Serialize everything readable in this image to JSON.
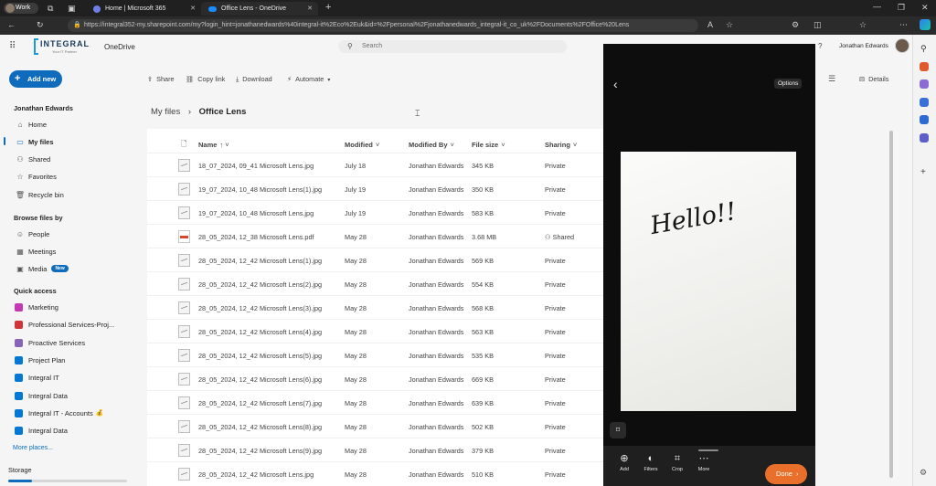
{
  "browser": {
    "profile": "Work",
    "tabs": [
      {
        "label": "Home | Microsoft 365",
        "active": false
      },
      {
        "label": "Office Lens - OneDrive",
        "active": true
      }
    ],
    "url": "https://integral352-my.sharepoint.com/my?login_hint=jonathanedwards%40integral-it%2Eco%2Euk&id=%2Fpersonal%2Fjonathanedwards_integral-it_co_uk%2FDocuments%2FOffice%20Lens"
  },
  "suite": {
    "logo_text": "INTEGRAL",
    "logo_tagline": "Your IT Partner",
    "app_name": "OneDrive",
    "search_placeholder": "Search",
    "user_name": "Jonathan Edwards"
  },
  "sidebar": {
    "add_new": "Add new",
    "user": "Jonathan Edwards",
    "items": [
      {
        "label": "Home",
        "icon": "home-icon"
      },
      {
        "label": "My files",
        "icon": "folder-icon",
        "selected": true
      },
      {
        "label": "Shared",
        "icon": "people-icon"
      },
      {
        "label": "Favorites",
        "icon": "star-icon"
      },
      {
        "label": "Recycle bin",
        "icon": "trash-icon"
      }
    ],
    "browse_heading": "Browse files by",
    "browse": [
      {
        "label": "People",
        "icon": "person-icon"
      },
      {
        "label": "Meetings",
        "icon": "calendar-icon"
      },
      {
        "label": "Media",
        "icon": "image-icon",
        "badge": "New"
      }
    ],
    "quick_access_heading": "Quick access",
    "quick_access": [
      {
        "label": "Marketing",
        "color": "#c239b3"
      },
      {
        "label": "Professional Services-Proj...",
        "color": "#d13438"
      },
      {
        "label": "Proactive Services",
        "color": "#8764b8"
      },
      {
        "label": "Project Plan",
        "color": "#0078d4"
      },
      {
        "label": "Integral IT",
        "color": "#0078d4"
      },
      {
        "label": "Integral Data",
        "color": "#0078d4"
      },
      {
        "label": "Integral IT - Accounts",
        "color": "#0078d4",
        "emoji": "💰"
      },
      {
        "label": "Integral Data",
        "color": "#0078d4"
      }
    ],
    "more_places": "More places...",
    "storage": "Storage"
  },
  "toolbar": {
    "share": "Share",
    "copy_link": "Copy link",
    "download": "Download",
    "automate": "Automate",
    "details": "Details"
  },
  "breadcrumb": {
    "parent": "My files",
    "current": "Office Lens"
  },
  "columns": [
    "Name",
    "Modified",
    "Modified By",
    "File size",
    "Sharing"
  ],
  "files": [
    {
      "name": "18_07_2024, 09_41 Microsoft Lens.jpg",
      "modified": "July 18",
      "by": "Jonathan Edwards",
      "size": "345 KB",
      "sharing": "Private",
      "type": "img"
    },
    {
      "name": "19_07_2024, 10_48 Microsoft Lens(1).jpg",
      "modified": "July 19",
      "by": "Jonathan Edwards",
      "size": "350 KB",
      "sharing": "Private",
      "type": "img"
    },
    {
      "name": "19_07_2024, 10_48 Microsoft Lens.jpg",
      "modified": "July 19",
      "by": "Jonathan Edwards",
      "size": "583 KB",
      "sharing": "Private",
      "type": "img"
    },
    {
      "name": "28_05_2024, 12_38 Microsoft Lens.pdf",
      "modified": "May 28",
      "by": "Jonathan Edwards",
      "size": "3.68 MB",
      "sharing": "Shared",
      "type": "pdf"
    },
    {
      "name": "28_05_2024, 12_42 Microsoft Lens(1).jpg",
      "modified": "May 28",
      "by": "Jonathan Edwards",
      "size": "569 KB",
      "sharing": "Private",
      "type": "img"
    },
    {
      "name": "28_05_2024, 12_42 Microsoft Lens(2).jpg",
      "modified": "May 28",
      "by": "Jonathan Edwards",
      "size": "554 KB",
      "sharing": "Private",
      "type": "img"
    },
    {
      "name": "28_05_2024, 12_42 Microsoft Lens(3).jpg",
      "modified": "May 28",
      "by": "Jonathan Edwards",
      "size": "568 KB",
      "sharing": "Private",
      "type": "img"
    },
    {
      "name": "28_05_2024, 12_42 Microsoft Lens(4).jpg",
      "modified": "May 28",
      "by": "Jonathan Edwards",
      "size": "563 KB",
      "sharing": "Private",
      "type": "img"
    },
    {
      "name": "28_05_2024, 12_42 Microsoft Lens(5).jpg",
      "modified": "May 28",
      "by": "Jonathan Edwards",
      "size": "535 KB",
      "sharing": "Private",
      "type": "img"
    },
    {
      "name": "28_05_2024, 12_42 Microsoft Lens(6).jpg",
      "modified": "May 28",
      "by": "Jonathan Edwards",
      "size": "669 KB",
      "sharing": "Private",
      "type": "img"
    },
    {
      "name": "28_05_2024, 12_42 Microsoft Lens(7).jpg",
      "modified": "May 28",
      "by": "Jonathan Edwards",
      "size": "639 KB",
      "sharing": "Private",
      "type": "img"
    },
    {
      "name": "28_05_2024, 12_42 Microsoft Lens(8).jpg",
      "modified": "May 28",
      "by": "Jonathan Edwards",
      "size": "502 KB",
      "sharing": "Private",
      "type": "img"
    },
    {
      "name": "28_05_2024, 12_42 Microsoft Lens(9).jpg",
      "modified": "May 28",
      "by": "Jonathan Edwards",
      "size": "379 KB",
      "sharing": "Private",
      "type": "img"
    },
    {
      "name": "28_05_2024, 12_42 Microsoft Lens.jpg",
      "modified": "May 28",
      "by": "Jonathan Edwards",
      "size": "510 KB",
      "sharing": "Private",
      "type": "img"
    }
  ],
  "lens": {
    "options": "Options",
    "handwriting": "Hello!!",
    "tools": [
      "Add",
      "Filters",
      "Crop",
      "More"
    ],
    "done": "Done"
  }
}
